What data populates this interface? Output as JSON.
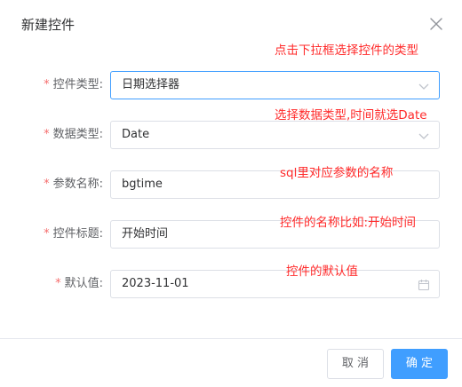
{
  "dialog": {
    "title": "新建控件",
    "close_icon": "close-icon"
  },
  "form": {
    "required_mark": "*",
    "rows": [
      {
        "label": "控件类型:",
        "value": "日期选择器",
        "suffix_icon": "chevron-down-icon"
      },
      {
        "label": "数据类型:",
        "value": "Date",
        "suffix_icon": "chevron-down-icon"
      },
      {
        "label": "参数名称:",
        "value": "bgtime"
      },
      {
        "label": "控件标题:",
        "value": "开始时间"
      },
      {
        "label": "默认值:",
        "value": "2023-11-01",
        "suffix_icon": "calendar-icon"
      }
    ]
  },
  "annotations": [
    "点击下拉框选择控件的类型",
    "选择数据类型,时间就选Date",
    "sql里对应参数的名称",
    "控件的名称比如:开始时间",
    "控件的默认值"
  ],
  "footer": {
    "cancel_label": "取 消",
    "ok_label": "确 定"
  },
  "colors": {
    "primary": "#409eff",
    "annotation": "#ff2a2a",
    "required": "#f56c6c"
  }
}
